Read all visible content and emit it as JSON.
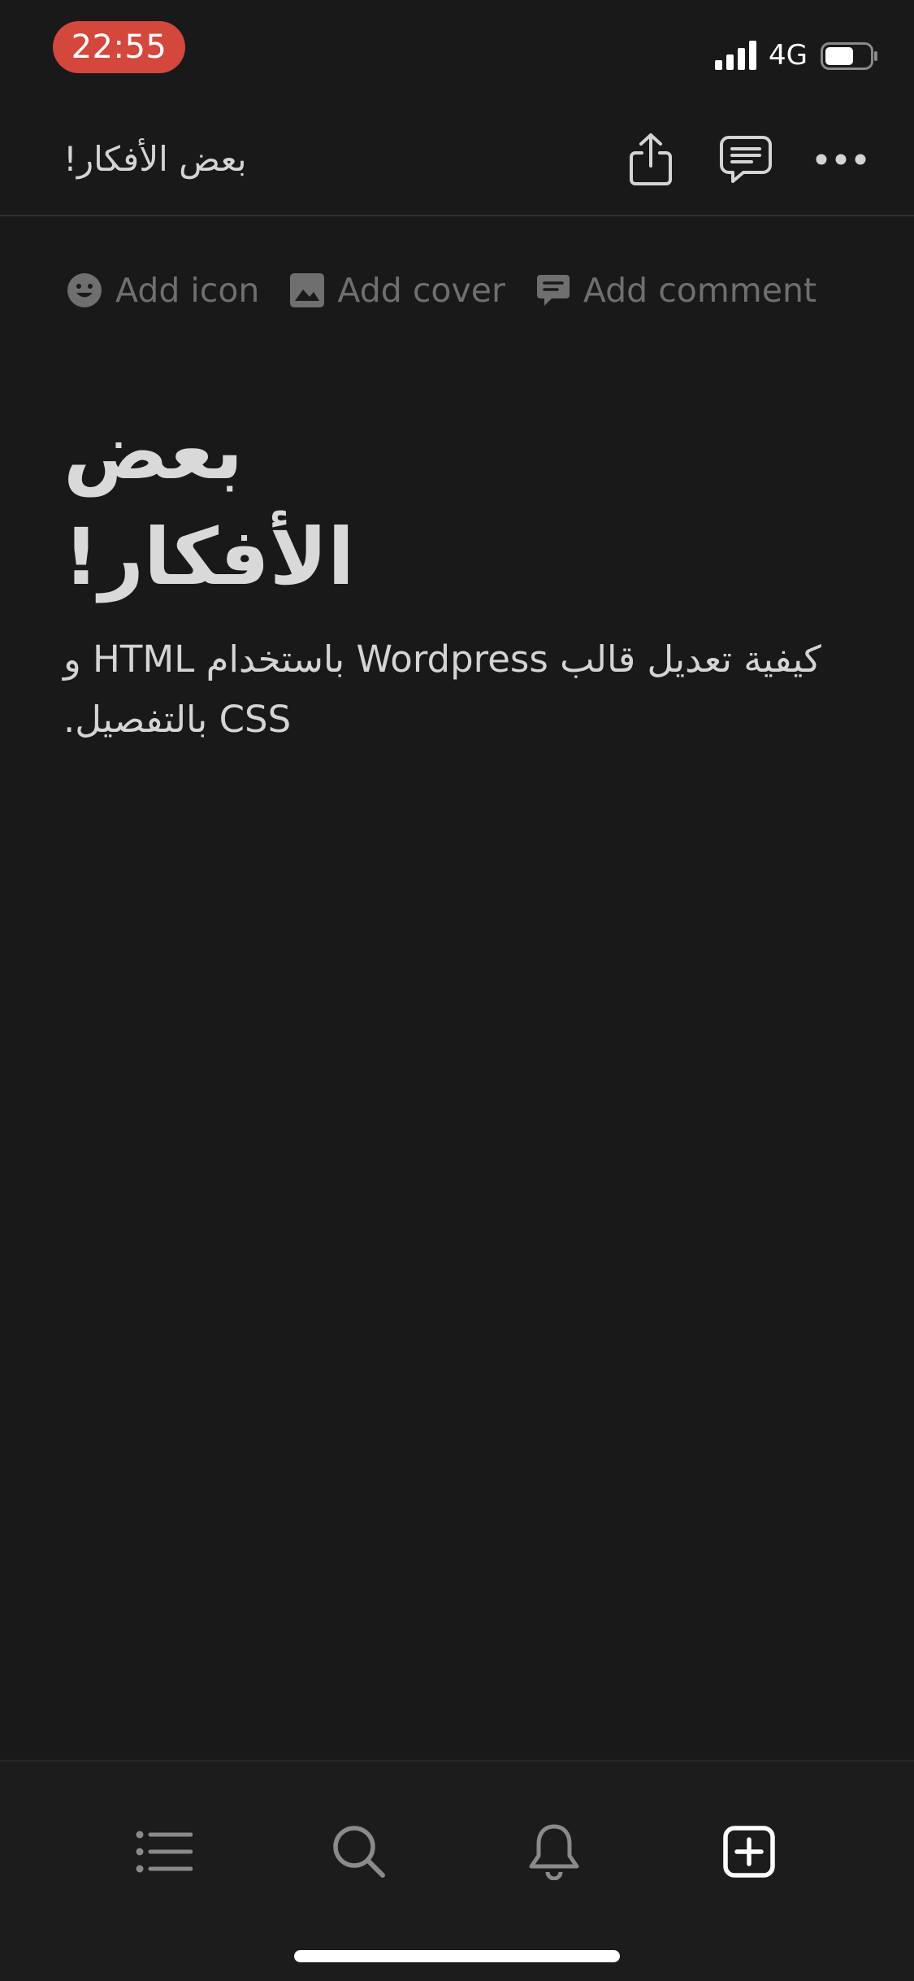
{
  "status_bar": {
    "time": "22:55",
    "network": "4G",
    "time_pill_color": "#d4473c",
    "battery_icon": "battery-icon",
    "signal_icon": "cellular-signal-icon"
  },
  "nav": {
    "title": "بعض الأفكار!",
    "icons": [
      "share-icon",
      "comment-bubble-icon",
      "more-dots-icon"
    ]
  },
  "page_actions": {
    "add_icon": "Add icon",
    "add_cover": "Add cover",
    "add_comment": "Add comment"
  },
  "page": {
    "title": "بعض الأفكار!",
    "body": "كيفية تعديل قالب Wordpress باستخدام HTML و CSS بالتفصيل."
  },
  "tab_bar": {
    "tabs": [
      "list-icon",
      "search-icon",
      "bell-icon",
      "new-page-icon"
    ],
    "active": "new-page-icon"
  },
  "colors": {
    "background": "#191919",
    "text": "#d4d4d4",
    "muted": "#6f6f6f"
  }
}
